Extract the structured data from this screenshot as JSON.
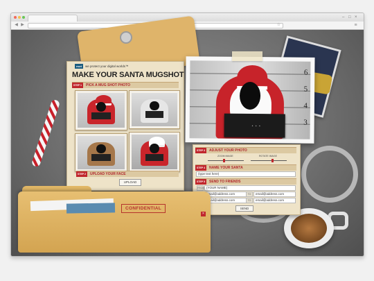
{
  "browser": {
    "window_controls": [
      "–",
      "□",
      "×"
    ],
    "nav": {
      "back": "◀",
      "forward": "▶"
    },
    "url": "",
    "star": "☆"
  },
  "brand": {
    "logo": "eset",
    "tagline": "we protect your digital worlds™"
  },
  "page": {
    "title": "MAKE YOUR SANTA MUGSHOT",
    "steps": [
      {
        "num": "STEP 1",
        "label": "PICK A MUG SHOT PHOTO"
      },
      {
        "num": "STEP 2",
        "label": "UPLOAD YOUR FACE"
      },
      {
        "num": "STEP 3",
        "label": "ADJUST YOUR PHOTO"
      },
      {
        "num": "STEP 4",
        "label": "NAME YOUR SANTA"
      },
      {
        "num": "STEP 5",
        "label": "SEND TO FRIENDS"
      }
    ],
    "upload_button": "UPLOAD",
    "height_marks": [
      "6",
      "5",
      "4",
      "3"
    ],
    "sign_text": "• • •",
    "adjust": {
      "slider1_label": "ZOOM IMAGE",
      "slider2_label": "ROTATE IMAGE",
      "slider1_value": 0.45,
      "slider2_value": 0.6
    },
    "name_field": "(type text here)",
    "friends": {
      "from_label": "FROM",
      "to_label": "TO",
      "your_name": "(YOUR NAME)",
      "emails": [
        "email@address.com",
        "email@address.com",
        "email@address.com",
        "email@address.com"
      ]
    },
    "send_button": "SEND",
    "confidential": "CONFIDENTIAL",
    "close": "×"
  }
}
